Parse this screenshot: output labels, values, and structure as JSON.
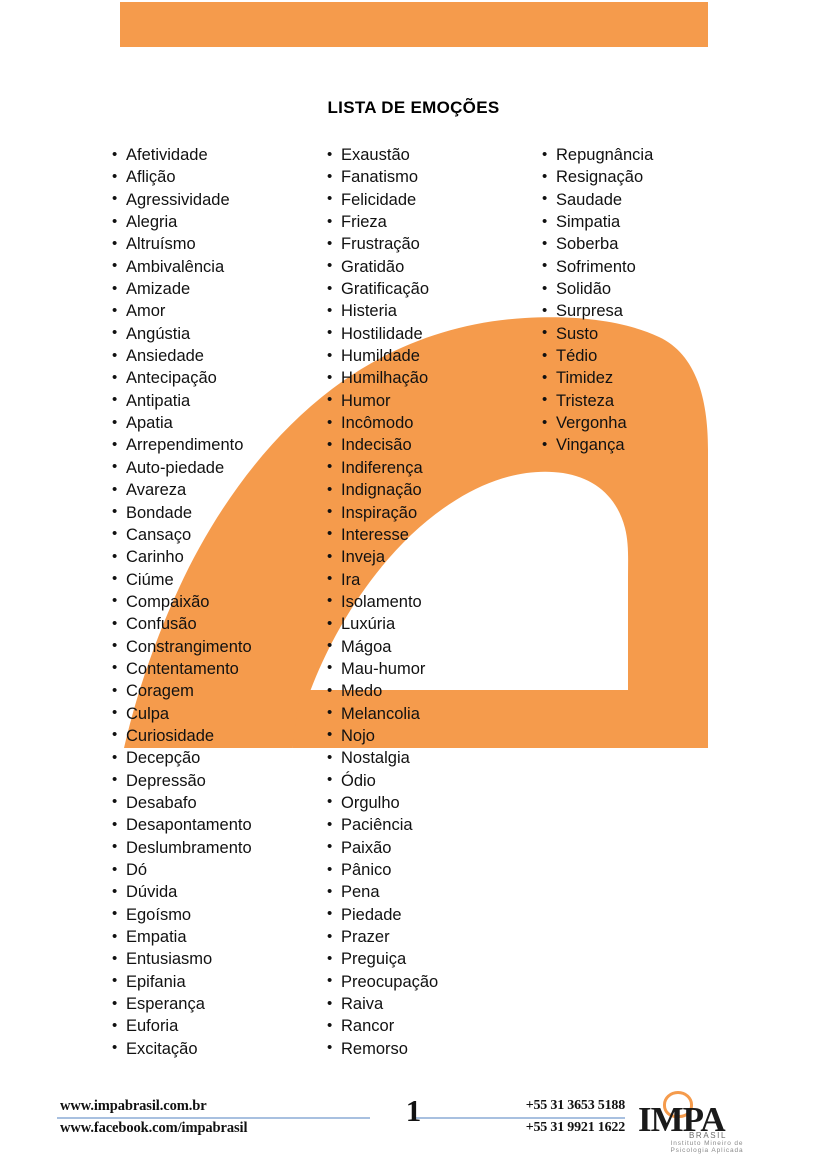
{
  "colors": {
    "accent_orange": "#f59b4c",
    "rule_blue": "#a8c0e0",
    "text": "#111111"
  },
  "header": {
    "title": "LISTA DE EMOÇÕES"
  },
  "columns": [
    {
      "id": "column-1",
      "items": [
        "Afetividade",
        "Aflição",
        "Agressividade",
        "Alegria",
        "Altruísmo",
        "Ambivalência",
        "Amizade",
        "Amor",
        "Angústia",
        "Ansiedade",
        "Antecipação",
        "Antipatia",
        "Apatia",
        "Arrependimento",
        "Auto-piedade",
        "Avareza",
        "Bondade",
        "Cansaço",
        "Carinho",
        "Ciúme",
        "Compaixão",
        "Confusão",
        "Constrangimento",
        "Contentamento",
        "Coragem",
        "Culpa",
        "Curiosidade",
        "Decepção",
        "Depressão",
        "Desabafo",
        "Desapontamento",
        "Deslumbramento",
        "Dó",
        "Dúvida",
        "Egoísmo",
        "Empatia",
        "Entusiasmo",
        "Epifania",
        "Esperança",
        "Euforia",
        "Excitação"
      ]
    },
    {
      "id": "column-2",
      "items": [
        "Exaustão",
        "Fanatismo",
        "Felicidade",
        "Frieza",
        "Frustração",
        "Gratidão",
        "Gratificação",
        "Histeria",
        "Hostilidade",
        "Humildade",
        "Humilhação",
        "Humor",
        "Incômodo",
        "Indecisão",
        "Indiferença",
        "Indignação",
        "Inspiração",
        "Interesse",
        "Inveja",
        "Ira",
        "Isolamento",
        "Luxúria",
        "Mágoa",
        "Mau-humor",
        "Medo",
        "Melancolia",
        "Nojo",
        "Nostalgia",
        "Ódio",
        "Orgulho",
        "Paciência",
        "Paixão",
        "Pânico",
        "Pena",
        "Piedade",
        "Prazer",
        "Preguiça",
        "Preocupação",
        "Raiva",
        "Rancor",
        "Remorso"
      ]
    },
    {
      "id": "column-3",
      "items": [
        "Repugnância",
        "Resignação",
        "Saudade",
        "Simpatia",
        "Soberba",
        "Sofrimento",
        "Solidão",
        "Surpresa",
        "Susto",
        "Tédio",
        "Timidez",
        "Tristeza",
        "Vergonha",
        "Vingança"
      ]
    }
  ],
  "footer": {
    "website": "www.impabrasil.com.br",
    "facebook": "www.facebook.com/impabrasil",
    "page_number": "1",
    "phone_1": "+55 31 3653 5188",
    "phone_2": "+55 31 9921 1622",
    "logo": {
      "wordmark": "IMPA",
      "country": "BRASIL",
      "tagline": "Instituto Mineiro de Psicologia Aplicada"
    }
  }
}
